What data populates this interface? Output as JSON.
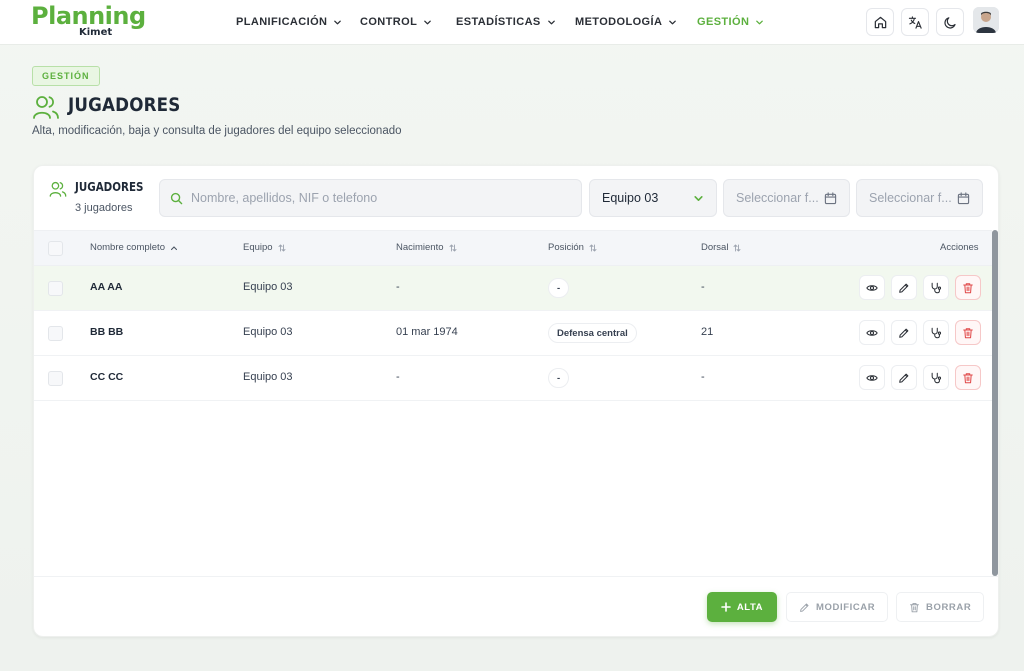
{
  "logo": {
    "main": "Planning",
    "sub": "Kimet"
  },
  "nav": [
    {
      "label": "PLANIFICACIÓN",
      "active": false
    },
    {
      "label": "CONTROL",
      "active": false
    },
    {
      "label": "ESTADÍSTICAS",
      "active": false
    },
    {
      "label": "METODOLOGÍA",
      "active": false
    },
    {
      "label": "GESTIÓN",
      "active": true
    }
  ],
  "header_icons": [
    "home-icon",
    "translate-icon",
    "moon-icon"
  ],
  "header": {
    "badge": "GESTIÓN",
    "title": "JUGADORES",
    "description": "Alta, modificación, baja y consulta de jugadores del equipo seleccionado"
  },
  "card": {
    "title": "JUGADORES",
    "count": "3 jugadores",
    "search_placeholder": "Nombre, apellidos, NIF o telefono",
    "team_select": "Equipo 03",
    "date_from_placeholder": "Seleccionar f...",
    "date_to_placeholder": "Seleccionar f..."
  },
  "table": {
    "columns": {
      "name": "Nombre completo",
      "team": "Equipo",
      "birth": "Nacimiento",
      "position": "Posición",
      "number": "Dorsal",
      "actions": "Acciones"
    },
    "rows": [
      {
        "name": "AA AA",
        "team": "Equipo 03",
        "birth": "-",
        "position": "-",
        "number": "-"
      },
      {
        "name": "BB BB",
        "team": "Equipo 03",
        "birth": "01 mar 1974",
        "position": "Defensa central",
        "number": "21"
      },
      {
        "name": "CC CC",
        "team": "Equipo 03",
        "birth": "-",
        "position": "-",
        "number": "-"
      }
    ]
  },
  "footer": {
    "add": "ALTA",
    "edit": "MODIFICAR",
    "delete": "BORRAR"
  },
  "colors": {
    "accent": "#5cb03e",
    "danger": "#e04848",
    "text": "#1f2937"
  }
}
